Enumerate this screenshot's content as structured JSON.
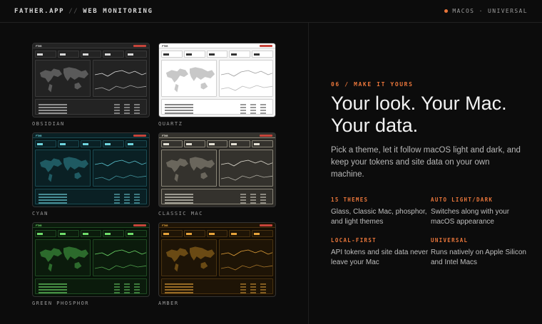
{
  "header": {
    "brand": "FATHER.APP",
    "separator": "//",
    "section": "WEB MONITORING",
    "platform": "MACOS · UNIVERSAL"
  },
  "themes": [
    {
      "label": "OBSIDIAN",
      "bg": "#1b1b1b",
      "panel": "#232323",
      "line": "#3a3a3a",
      "text": "#d8d8d8",
      "map": "#5a5a5a",
      "chart": "#e0e0e0"
    },
    {
      "label": "QUARTZ",
      "bg": "#f4f4f4",
      "panel": "#ffffff",
      "line": "#d0d0d0",
      "text": "#333333",
      "map": "#c8c8c8",
      "chart": "#9a9a9a"
    },
    {
      "label": "CYAN",
      "bg": "#061618",
      "panel": "#0a2024",
      "line": "#1a4a52",
      "text": "#6fd6e0",
      "map": "#1f5a62",
      "chart": "#5cc8d4"
    },
    {
      "label": "CLASSIC MAC",
      "bg": "#2b2925",
      "panel": "#34322d",
      "line": "#8a8678",
      "text": "#e6e2d6",
      "map": "#6a665c",
      "chart": "#e6e2d6"
    },
    {
      "label": "GREEN PHOSPHOR",
      "bg": "#071208",
      "panel": "#0b1b0c",
      "line": "#1f4a22",
      "text": "#6fdc6a",
      "map": "#2c6a2c",
      "chart": "#6fdc6a"
    },
    {
      "label": "AMBER",
      "bg": "#140d04",
      "panel": "#1e1406",
      "line": "#4a3310",
      "text": "#e6a33a",
      "map": "#6a4a14",
      "chart": "#e6a33a"
    }
  ],
  "section": {
    "eyebrow": "06 / MAKE IT YOURS",
    "headline": "Your look. Your Mac. Your data.",
    "lede": "Pick a theme, let it follow macOS light and dark, and keep your tokens and site data on your own machine."
  },
  "features": [
    {
      "title": "15 THEMES",
      "body": "Glass, Classic Mac, phosphor, and light themes"
    },
    {
      "title": "AUTO LIGHT/DARK",
      "body": "Switches along with your macOS appearance"
    },
    {
      "title": "LOCAL-FIRST",
      "body": "API tokens and site data never leave your Mac"
    },
    {
      "title": "UNIVERSAL",
      "body": "Runs natively on Apple Silicon and Intel Macs"
    }
  ],
  "accent": "#e8753a"
}
